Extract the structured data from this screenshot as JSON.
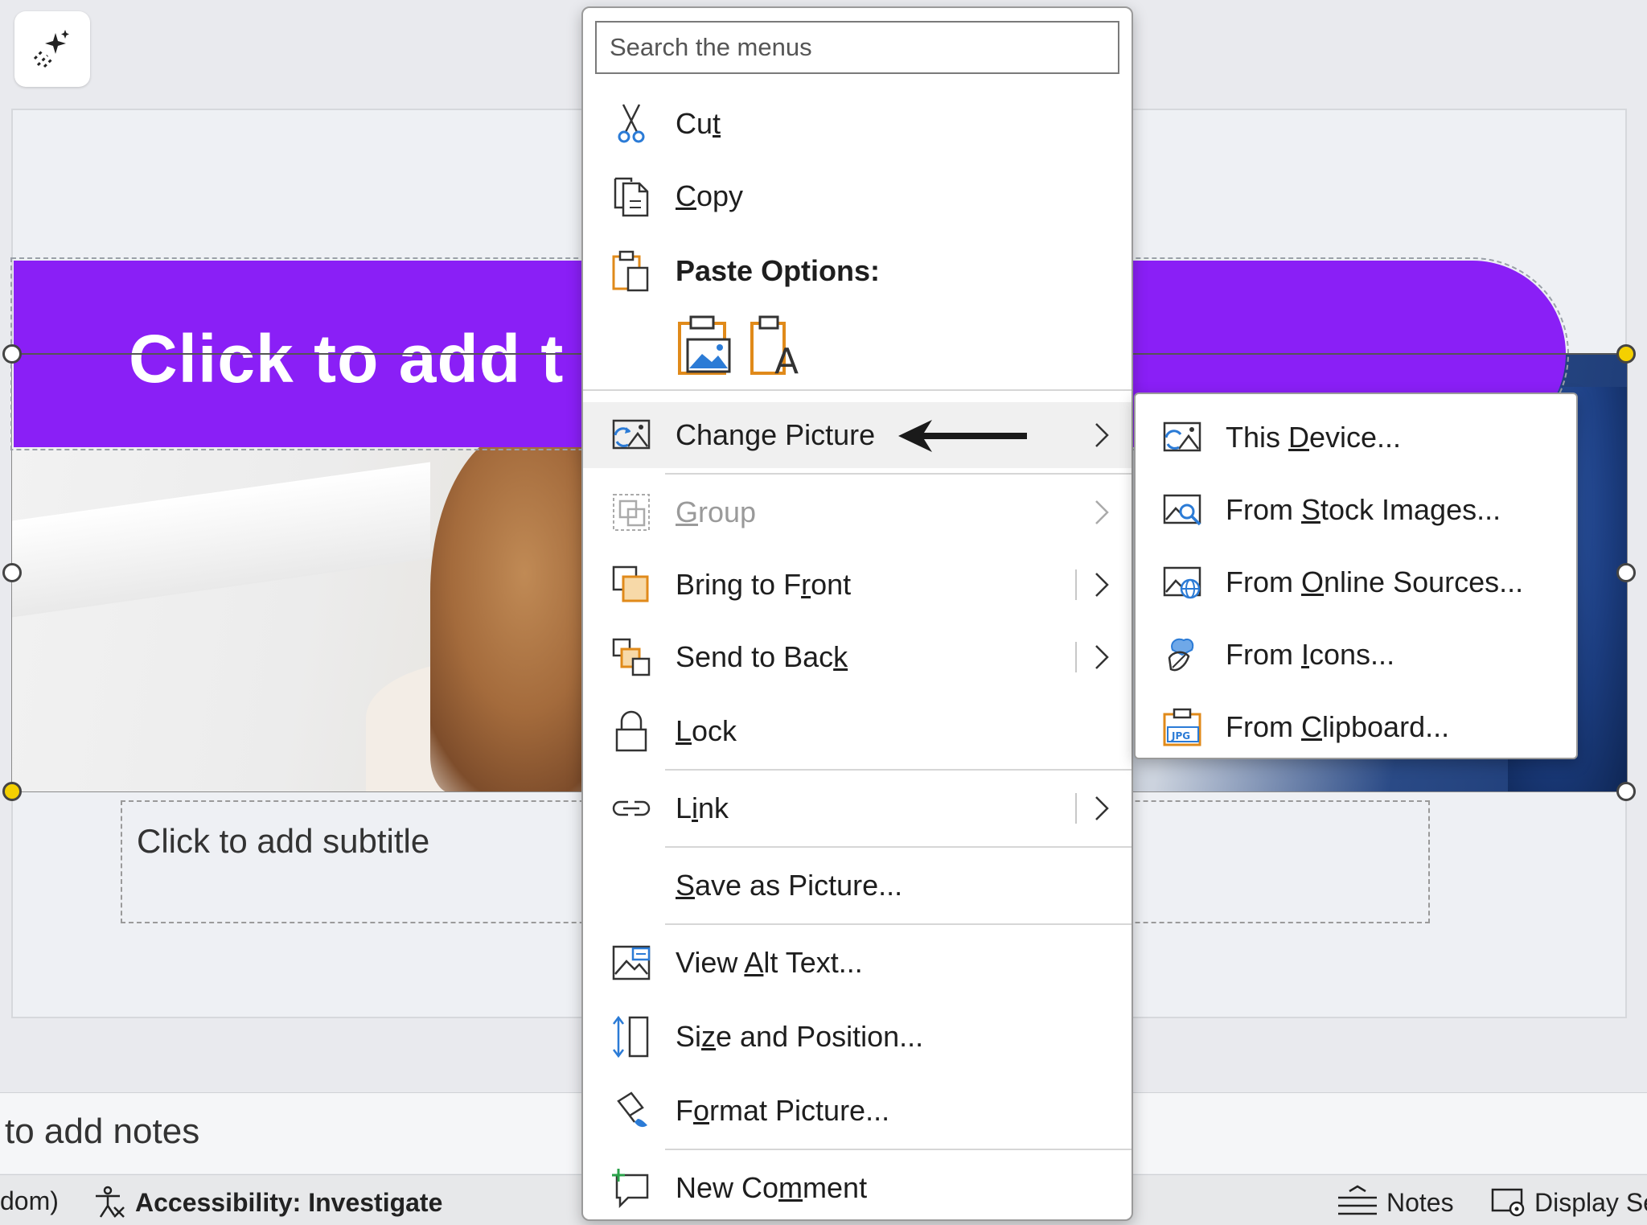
{
  "slide": {
    "title_placeholder": "Click to add t",
    "subtitle_placeholder": "Click to add subtitle"
  },
  "notes": {
    "placeholder": "to add notes"
  },
  "status_bar": {
    "left_fragment": "dom)",
    "accessibility": "Accessibility: Investigate",
    "notes": "Notes",
    "display": "Display Se"
  },
  "context_menu": {
    "search_placeholder": "Search the menus",
    "cut": {
      "pre": "Cu",
      "key": "t",
      "post": ""
    },
    "copy": {
      "pre": "",
      "key": "C",
      "post": "opy"
    },
    "paste_options": "Paste Options:",
    "paste_icons": [
      "paste-picture-icon",
      "paste-keep-text-only-icon"
    ],
    "change_picture": {
      "pre": "Chan",
      "key": "g",
      "post": "e Picture"
    },
    "group": {
      "pre": "",
      "key": "G",
      "post": "roup"
    },
    "bring_to_front": {
      "pre": "Bring to F",
      "key": "r",
      "post": "ont"
    },
    "send_to_back": {
      "pre": "Send to Bac",
      "key": "k",
      "post": ""
    },
    "lock": {
      "pre": "",
      "key": "L",
      "post": "ock"
    },
    "link": {
      "pre": "L",
      "key": "i",
      "post": "nk"
    },
    "save_as_picture": {
      "pre": "",
      "key": "S",
      "post": "ave as Picture..."
    },
    "view_alt_text": {
      "pre": "View ",
      "key": "A",
      "post": "lt Text..."
    },
    "size_and_position": {
      "pre": "Si",
      "key": "z",
      "post": "e and Position..."
    },
    "format_picture": {
      "pre": "F",
      "key": "o",
      "post": "rmat Picture..."
    },
    "new_comment": {
      "pre": "New Co",
      "key": "m",
      "post": "ment"
    }
  },
  "submenu": {
    "this_device": {
      "pre": "This ",
      "key": "D",
      "post": "evice..."
    },
    "stock_images": {
      "pre": "From ",
      "key": "S",
      "post": "tock Images..."
    },
    "online_sources": {
      "pre": "From ",
      "key": "O",
      "post": "nline Sources..."
    },
    "icons": {
      "pre": "From ",
      "key": "I",
      "post": "cons..."
    },
    "clipboard": {
      "pre": "From ",
      "key": "C",
      "post": "lipboard..."
    }
  },
  "colors": {
    "title_band": "#8a1ff6",
    "accent_blue": "#2b7bd6",
    "accent_orange": "#e08a1a",
    "handle_yellow": "#f4d000"
  }
}
